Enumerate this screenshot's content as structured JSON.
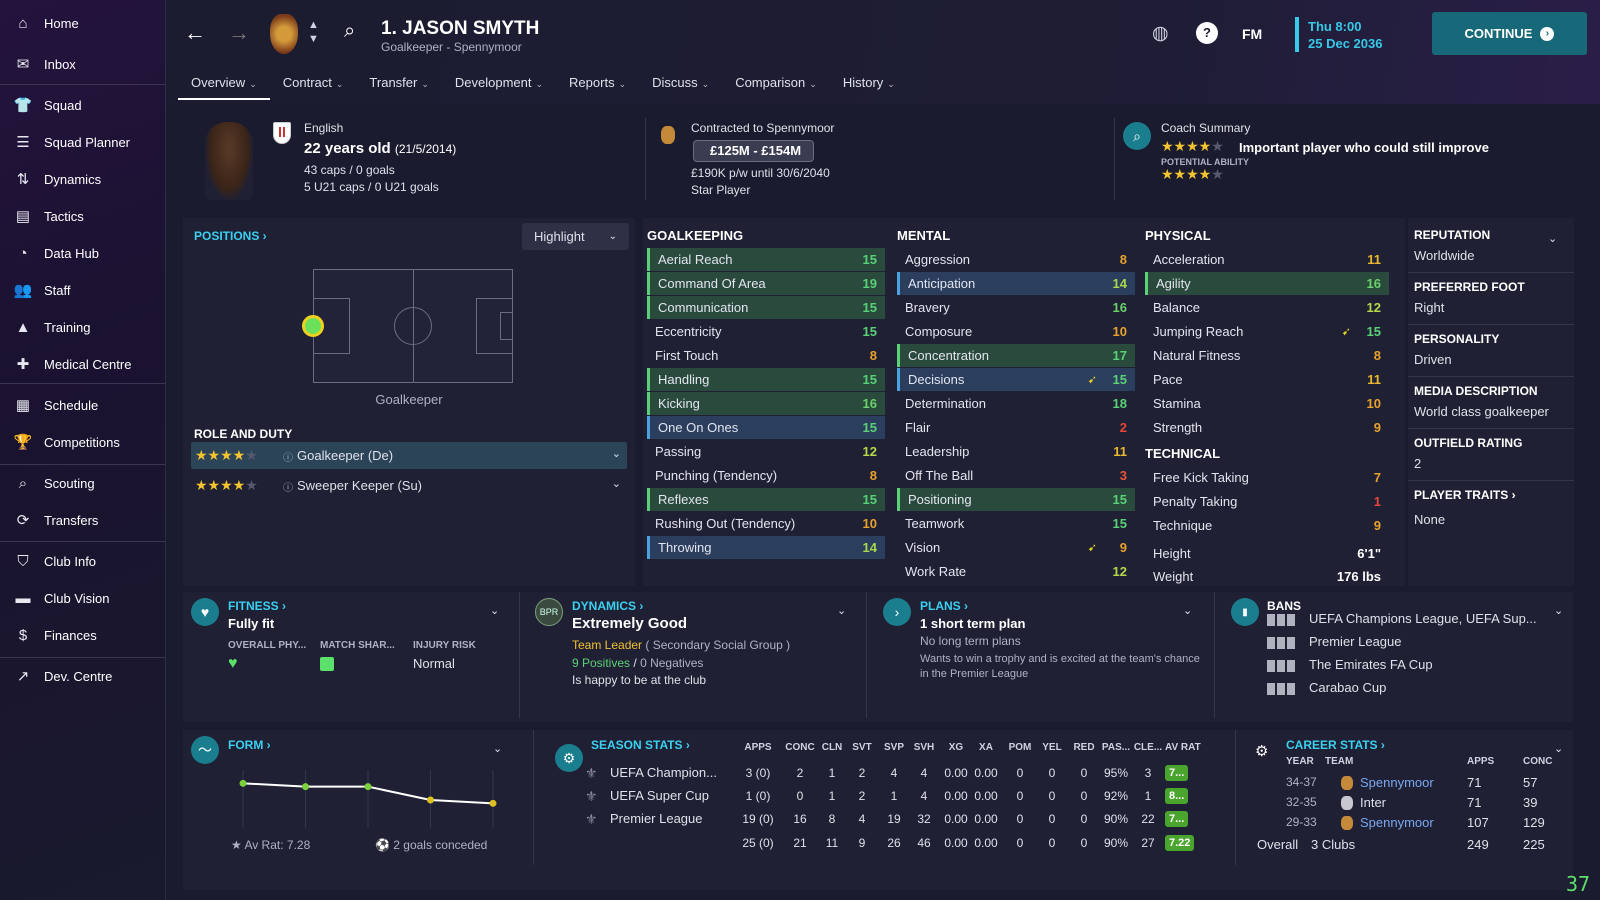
{
  "sidebar": {
    "items": [
      {
        "label": "Home",
        "icon": "home-icon",
        "glyph": "⌂"
      },
      {
        "label": "Inbox",
        "icon": "inbox-icon",
        "glyph": "✉"
      },
      {
        "label": "Squad",
        "icon": "squad-icon",
        "glyph": "👕"
      },
      {
        "label": "Squad Planner",
        "icon": "planner-icon",
        "glyph": "☰"
      },
      {
        "label": "Dynamics",
        "icon": "dynamics-icon",
        "glyph": "⇅"
      },
      {
        "label": "Tactics",
        "icon": "tactics-icon",
        "glyph": "▤"
      },
      {
        "label": "Data Hub",
        "icon": "data-hub-icon",
        "glyph": "◔"
      },
      {
        "label": "Staff",
        "icon": "staff-icon",
        "glyph": "👥"
      },
      {
        "label": "Training",
        "icon": "training-icon",
        "glyph": "▲"
      },
      {
        "label": "Medical Centre",
        "icon": "medical-icon",
        "glyph": "✚"
      },
      {
        "label": "Schedule",
        "icon": "schedule-icon",
        "glyph": "▦"
      },
      {
        "label": "Competitions",
        "icon": "trophy-icon",
        "glyph": "🏆"
      },
      {
        "label": "Scouting",
        "icon": "scouting-icon",
        "glyph": "⌕"
      },
      {
        "label": "Transfers",
        "icon": "transfers-icon",
        "glyph": "⟳"
      },
      {
        "label": "Club Info",
        "icon": "club-info-icon",
        "glyph": "⛉"
      },
      {
        "label": "Club Vision",
        "icon": "club-vision-icon",
        "glyph": "▬"
      },
      {
        "label": "Finances",
        "icon": "finances-icon",
        "glyph": "$"
      },
      {
        "label": "Dev. Centre",
        "icon": "dev-centre-icon",
        "glyph": "↗"
      }
    ]
  },
  "header": {
    "player_name": "1. JASON SMYTH",
    "player_sub": "Goalkeeper - Spennymoor",
    "fm": "FM",
    "date_time": "Thu 8:00",
    "date": "25 Dec 2036",
    "continue": "CONTINUE",
    "tabs": [
      "Overview",
      "Contract",
      "Transfer",
      "Development",
      "Reports",
      "Discuss",
      "Comparison",
      "History"
    ]
  },
  "profile": {
    "nationality": "English",
    "age": "22 years old",
    "dob": "(21/5/2014)",
    "caps": "43 caps / 0 goals",
    "u21": "5 U21 caps / 0 U21 goals",
    "contract_title": "Contracted to Spennymoor",
    "value": "£125M - £154M",
    "wage": "£190K p/w until 30/6/2040",
    "status": "Star Player",
    "coach_title": "Coach Summary",
    "coach_text": "Important player who could still improve",
    "potential_label": "POTENTIAL ABILITY",
    "current_stars": 4,
    "potential_stars": 4
  },
  "positions": {
    "title": "POSITIONS",
    "highlight": "Highlight",
    "position_label": "Goalkeeper",
    "role_title": "ROLE AND DUTY",
    "roles": [
      {
        "label": "Goalkeeper (De)",
        "stars": 4
      },
      {
        "label": "Sweeper Keeper (Su)",
        "stars": 4
      }
    ]
  },
  "attributes": {
    "goalkeeping_title": "GOALKEEPING",
    "goalkeeping": [
      {
        "n": "Aerial Reach",
        "v": "15",
        "h": "g"
      },
      {
        "n": "Command Of Area",
        "v": "19",
        "h": "g"
      },
      {
        "n": "Communication",
        "v": "15",
        "h": "g"
      },
      {
        "n": "Eccentricity",
        "v": "15",
        "h": ""
      },
      {
        "n": "First Touch",
        "v": "8",
        "h": ""
      },
      {
        "n": "Handling",
        "v": "15",
        "h": "g"
      },
      {
        "n": "Kicking",
        "v": "16",
        "h": "g"
      },
      {
        "n": "One On Ones",
        "v": "15",
        "h": "b"
      },
      {
        "n": "Passing",
        "v": "12",
        "h": ""
      },
      {
        "n": "Punching (Tendency)",
        "v": "8",
        "h": ""
      },
      {
        "n": "Reflexes",
        "v": "15",
        "h": "g"
      },
      {
        "n": "Rushing Out (Tendency)",
        "v": "10",
        "h": ""
      },
      {
        "n": "Throwing",
        "v": "14",
        "h": "b"
      }
    ],
    "mental_title": "MENTAL",
    "mental": [
      {
        "n": "Aggression",
        "v": "8",
        "h": ""
      },
      {
        "n": "Anticipation",
        "v": "14",
        "h": "b"
      },
      {
        "n": "Bravery",
        "v": "16",
        "h": ""
      },
      {
        "n": "Composure",
        "v": "10",
        "h": ""
      },
      {
        "n": "Concentration",
        "v": "17",
        "h": "g"
      },
      {
        "n": "Decisions",
        "v": "15",
        "h": "b",
        "arrow": true
      },
      {
        "n": "Determination",
        "v": "18",
        "h": ""
      },
      {
        "n": "Flair",
        "v": "2",
        "h": ""
      },
      {
        "n": "Leadership",
        "v": "11",
        "h": ""
      },
      {
        "n": "Off The Ball",
        "v": "3",
        "h": ""
      },
      {
        "n": "Positioning",
        "v": "15",
        "h": "g"
      },
      {
        "n": "Teamwork",
        "v": "15",
        "h": ""
      },
      {
        "n": "Vision",
        "v": "9",
        "h": "",
        "arrow": true
      },
      {
        "n": "Work Rate",
        "v": "12",
        "h": ""
      }
    ],
    "physical_title": "PHYSICAL",
    "physical": [
      {
        "n": "Acceleration",
        "v": "11",
        "h": ""
      },
      {
        "n": "Agility",
        "v": "16",
        "h": "g"
      },
      {
        "n": "Balance",
        "v": "12",
        "h": ""
      },
      {
        "n": "Jumping Reach",
        "v": "15",
        "h": "",
        "arrow": true
      },
      {
        "n": "Natural Fitness",
        "v": "8",
        "h": ""
      },
      {
        "n": "Pace",
        "v": "11",
        "h": ""
      },
      {
        "n": "Stamina",
        "v": "10",
        "h": ""
      },
      {
        "n": "Strength",
        "v": "9",
        "h": ""
      }
    ],
    "technical_title": "TECHNICAL",
    "technical": [
      {
        "n": "Free Kick Taking",
        "v": "7",
        "h": ""
      },
      {
        "n": "Penalty Taking",
        "v": "1",
        "h": ""
      },
      {
        "n": "Technique",
        "v": "9",
        "h": ""
      }
    ],
    "height_label": "Height",
    "height": "6'1\"",
    "weight_label": "Weight",
    "weight": "176 lbs"
  },
  "info": {
    "reputation_h": "REPUTATION",
    "reputation": "Worldwide",
    "foot_h": "PREFERRED FOOT",
    "foot": "Right",
    "personality_h": "PERSONALITY",
    "personality": "Driven",
    "media_h": "MEDIA DESCRIPTION",
    "media": "World class goalkeeper",
    "outfield_h": "OUTFIELD RATING",
    "outfield": "2",
    "traits_h": "PLAYER TRAITS",
    "traits": "None"
  },
  "fitness": {
    "title": "FITNESS",
    "status": "Fully fit",
    "col1": "OVERALL PHY...",
    "col2": "MATCH SHAR...",
    "col3": "INJURY RISK",
    "risk": "Normal"
  },
  "dynamics": {
    "title": "DYNAMICS",
    "badge": "BPR",
    "status": "Extremely Good",
    "role": "Team Leader",
    "group": "( Secondary Social Group )",
    "pos": "9 Positives",
    "sep": "/",
    "neg": "0 Negatives",
    "happy": "Is happy to be at the club"
  },
  "plans": {
    "title": "PLANS",
    "status": "1 short term plan",
    "long": "No long term plans",
    "desc": "Wants to win a trophy and is excited at the team's chance in the Premier League"
  },
  "bans": {
    "title": "BANS",
    "items": [
      "UEFA Champions League, UEFA Sup...",
      "Premier League",
      "The Emirates FA Cup",
      "Carabao Cup"
    ]
  },
  "form": {
    "title": "FORM",
    "avrat": "Av Rat: 7.28",
    "conceded": "2 goals conceded",
    "points": [
      7.6,
      7.5,
      7.5,
      7.1,
      7.0
    ]
  },
  "season": {
    "title": "SEASON STATS",
    "headers": [
      "APPS",
      "CONC",
      "CLN",
      "SVT",
      "SVP",
      "SVH",
      "XG",
      "XA",
      "POM",
      "YEL",
      "RED",
      "PAS...",
      "CLE...",
      "AV RAT"
    ],
    "rows": [
      {
        "comp": "UEFA Champion...",
        "vals": [
          "3 (0)",
          "2",
          "1",
          "2",
          "4",
          "4",
          "0.00",
          "0.00",
          "0",
          "0",
          "0",
          "95%",
          "3"
        ],
        "rat": "7..."
      },
      {
        "comp": "UEFA Super Cup",
        "vals": [
          "1 (0)",
          "0",
          "1",
          "2",
          "1",
          "4",
          "0.00",
          "0.00",
          "0",
          "0",
          "0",
          "92%",
          "1"
        ],
        "rat": "8..."
      },
      {
        "comp": "Premier League",
        "vals": [
          "19 (0)",
          "16",
          "8",
          "4",
          "19",
          "32",
          "0.00",
          "0.00",
          "0",
          "0",
          "0",
          "90%",
          "22"
        ],
        "rat": "7..."
      }
    ],
    "total": {
      "vals": [
        "25 (0)",
        "21",
        "11",
        "9",
        "26",
        "46",
        "0.00",
        "0.00",
        "0",
        "0",
        "0",
        "90%",
        "27"
      ],
      "rat": "7.22"
    }
  },
  "career": {
    "title": "CAREER STATS",
    "headers": [
      "YEAR",
      "TEAM",
      "APPS",
      "CONC"
    ],
    "rows": [
      {
        "year": "34-37",
        "team": "Spennymoor",
        "apps": "71",
        "conc": "57"
      },
      {
        "year": "32-35",
        "team": "Inter",
        "apps": "71",
        "conc": "39"
      },
      {
        "year": "29-33",
        "team": "Spennymoor",
        "apps": "107",
        "conc": "129"
      }
    ],
    "overall": "Overall",
    "clubs": "3 Clubs",
    "apps": "249",
    "conc": "225"
  },
  "corner": "37"
}
